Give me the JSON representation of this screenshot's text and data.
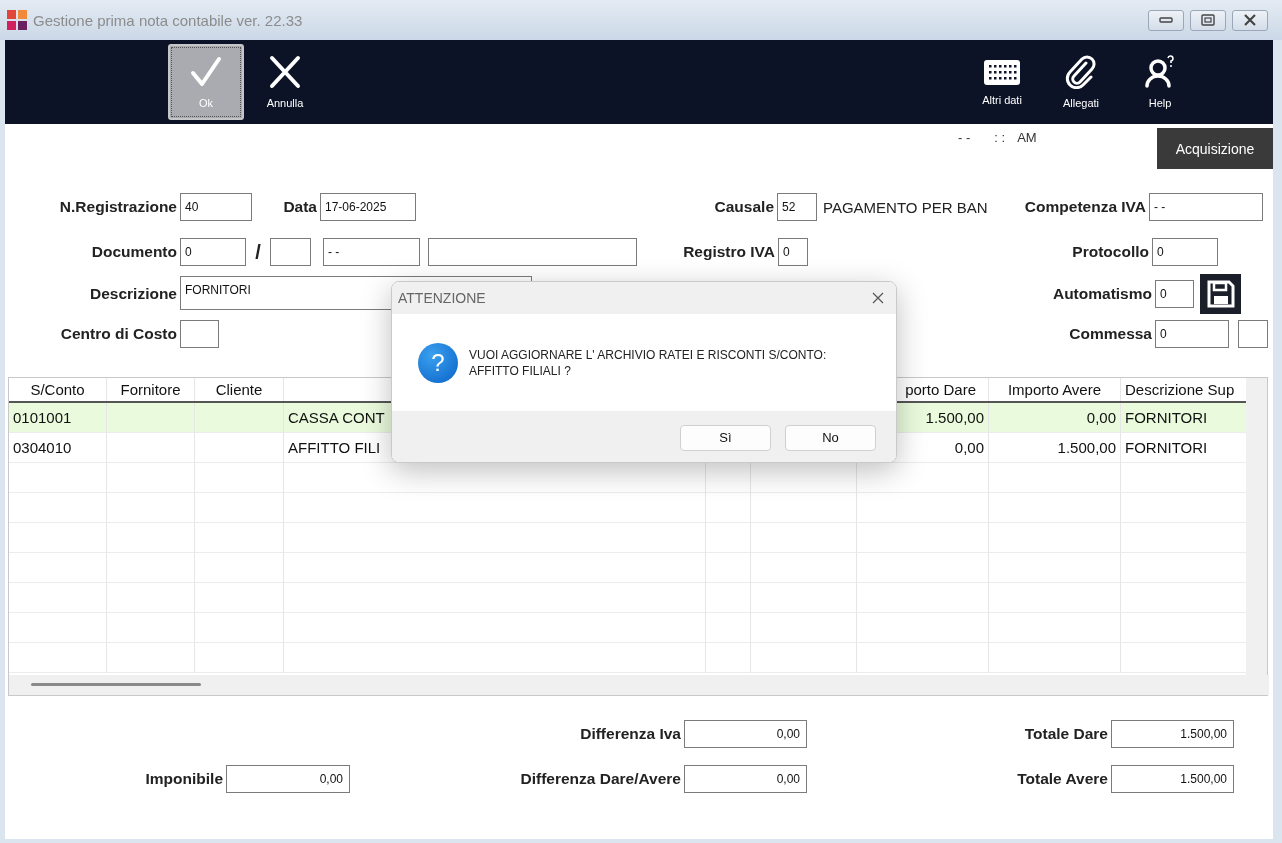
{
  "window": {
    "title": "Gestione prima nota contabile ver. 22.33"
  },
  "toolbar": [
    {
      "label": "Ok",
      "selected": true
    },
    {
      "label": "Annulla",
      "selected": false
    },
    {
      "label": "Altri dati",
      "selected": false
    },
    {
      "label": "Allegati",
      "selected": false
    },
    {
      "label": "Help",
      "selected": false
    }
  ],
  "clock": {
    "date": "- -",
    "time": ": :",
    "period": "AM"
  },
  "acquire_button": "Acquisizione",
  "form": {
    "n_registrazione": {
      "label": "N.Registrazione",
      "value": "40"
    },
    "data": {
      "label": "Data",
      "value": "17-06-2025"
    },
    "causale": {
      "label": "Causale",
      "value": "52",
      "description": "PAGAMENTO PER BAN"
    },
    "competenza_iva": {
      "label": "Competenza IVA",
      "value": "- -"
    },
    "documento": {
      "label": "Documento",
      "number": "0",
      "separator": "/",
      "date": "- -"
    },
    "registro_iva": {
      "label": "Registro IVA",
      "value": "0"
    },
    "protocollo": {
      "label": "Protocollo",
      "value": "0"
    },
    "descrizione": {
      "label": "Descrizione",
      "value": "FORNITORI"
    },
    "automatismo": {
      "label": "Automatismo",
      "value": "0"
    },
    "centro_di_costo": {
      "label": "Centro di Costo"
    },
    "commessa": {
      "label": "Commessa",
      "value": "0"
    }
  },
  "table": {
    "columns": [
      "S/Conto",
      "Fornitore",
      "Cliente",
      "porto Dare",
      "Importo Avere",
      "Descrizione Sup"
    ],
    "rows": [
      {
        "selected": true,
        "s_conto": "0101001",
        "column_4": "CASSA CONT",
        "importo_dare": "1.500,00",
        "importo_avere": "0,00",
        "descrizione_sup": "FORNITORI"
      },
      {
        "selected": false,
        "s_conto": "0304010",
        "column_4": "AFFITTO FILI",
        "importo_dare": "0,00",
        "importo_avere": "1.500,00",
        "descrizione_sup": "FORNITORI"
      }
    ]
  },
  "totals": {
    "differenza_iva": {
      "label": "Differenza Iva",
      "value": "0,00"
    },
    "totale_dare": {
      "label": "Totale Dare",
      "value": "1.500,00"
    },
    "imponibile": {
      "label": "Imponibile",
      "value": "0,00"
    },
    "differenza_dare_avere": {
      "label": "Differenza Dare/Avere",
      "value": "0,00"
    },
    "totale_avere": {
      "label": "Totale Avere",
      "value": "1.500,00"
    }
  },
  "dialog": {
    "title": "ATTENZIONE",
    "icon": "?",
    "message": "VUOI AGGIORNARE L' ARCHIVIO RATEI E RISCONTI S/CONTO: AFFITTO FILIALI ?",
    "buttons": [
      "Sì",
      "No"
    ]
  }
}
